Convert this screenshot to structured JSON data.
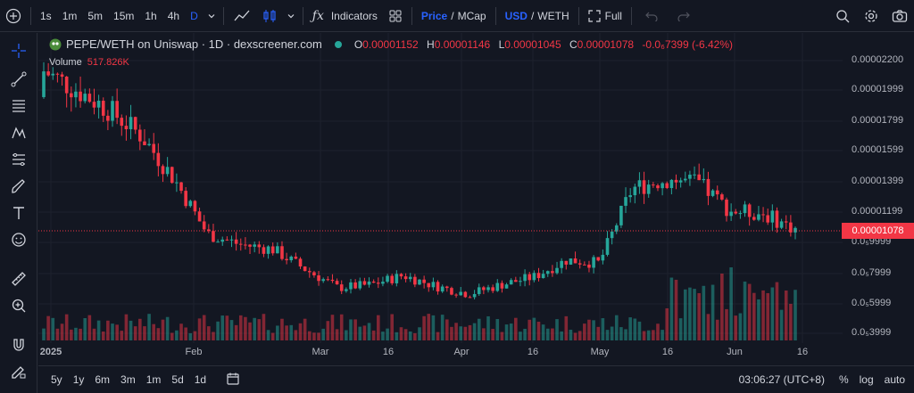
{
  "topbar": {
    "add_icon": "plus-circle-icon",
    "intervals": [
      "1s",
      "1m",
      "5m",
      "15m",
      "1h",
      "4h",
      "D"
    ],
    "active_interval": "D",
    "indicators_label": "Indicators",
    "price_label": "Price",
    "mcap_label": "MCap",
    "slash": "/",
    "usd_label": "USD",
    "weth_label": "WETH",
    "full_label": "Full"
  },
  "legend": {
    "pair": "PEPE/WETH on Uniswap · 1D · dexscreener.com",
    "o_label": "O",
    "o_value": "0.00001152",
    "h_label": "H",
    "h_value": "0.00001146",
    "l_label": "L",
    "l_value": "0.00001045",
    "c_label": "C",
    "c_value": "0.00001078",
    "change": "-0.0₆7399 (-6.42%)",
    "volume_label": "Volume",
    "volume_value": "517.826K"
  },
  "price_axis": {
    "ticks": [
      "0.00002200",
      "0.00001999",
      "0.00001799",
      "0.00001599",
      "0.00001399",
      "0.00001199",
      "0.0₅9999",
      "0.0₅7999",
      "0.0₅5999",
      "0.0₅3999"
    ],
    "current_price": "0.00001078"
  },
  "time_axis": {
    "ticks": [
      "2025",
      "Feb",
      "Mar",
      "16",
      "Apr",
      "16",
      "May",
      "16",
      "Jun",
      "16"
    ]
  },
  "bottombar": {
    "ranges": [
      "5y",
      "1y",
      "6m",
      "3m",
      "1m",
      "5d",
      "1d"
    ],
    "clock": "03:06:27 (UTC+8)",
    "percent_label": "%",
    "log_label": "log",
    "auto_label": "auto"
  },
  "colors": {
    "up": "#26a69a",
    "down": "#f23645",
    "accent": "#2962ff"
  },
  "chart_data": {
    "type": "candlestick",
    "title": "PEPE/WETH on Uniswap · 1D · dexscreener.com",
    "ylim": [
      3.6e-06,
      2.26e-05
    ],
    "x": [
      "2025-01-01",
      "2025-01-07",
      "2025-01-14",
      "2025-01-21",
      "2025-01-28",
      "2025-02-04",
      "2025-02-11",
      "2025-02-18",
      "2025-02-25",
      "2025-03-04",
      "2025-03-11",
      "2025-03-18",
      "2025-03-25",
      "2025-04-01",
      "2025-04-08",
      "2025-04-15",
      "2025-04-22",
      "2025-04-29",
      "2025-05-06",
      "2025-05-13",
      "2025-05-20",
      "2025-05-27",
      "2025-06-03",
      "2025-06-10"
    ],
    "close": [
      2.1e-05,
      1.98e-05,
      1.85e-05,
      1.68e-05,
      1.4e-05,
      1.05e-05,
      9.8e-06,
      9.5e-06,
      8.2e-06,
      7e-06,
      7.2e-06,
      7.8e-06,
      7.1e-06,
      6.6e-06,
      7.2e-06,
      7.7e-06,
      8.8e-06,
      8.6e-06,
      1.34e-05,
      1.4e-05,
      1.38e-05,
      1.2e-05,
      1.18e-05,
      1.08e-05
    ],
    "volume_scale": "relative"
  }
}
